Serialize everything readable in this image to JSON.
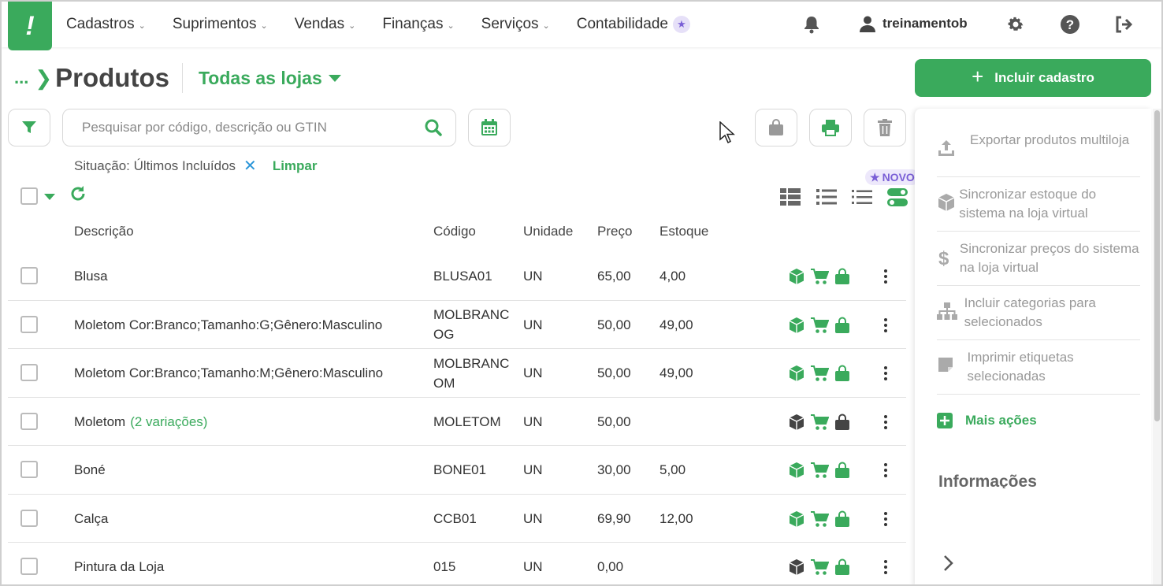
{
  "nav": {
    "items": [
      {
        "label": "Cadastros"
      },
      {
        "label": "Suprimentos"
      },
      {
        "label": "Vendas"
      },
      {
        "label": "Finanças"
      },
      {
        "label": "Serviços"
      },
      {
        "label": "Contabilidade"
      }
    ],
    "username": "treinamentob",
    "logo_text": "!"
  },
  "header": {
    "breadcrumb_dots": "...",
    "title": "Produtos",
    "store_select": "Todas as lojas",
    "primary_button": "Incluir cadastro"
  },
  "search": {
    "placeholder": "Pesquisar por código, descrição ou GTIN"
  },
  "filter": {
    "label": "Situação: Últimos Incluídos",
    "clear": "Limpar"
  },
  "badge_new": "NOVO",
  "table": {
    "headers": {
      "description": "Descrição",
      "code": "Código",
      "unit": "Unidade",
      "price": "Preço",
      "stock": "Estoque"
    },
    "rows": [
      {
        "description": "Blusa",
        "variation": "",
        "code": "BLUSA01",
        "unit": "UN",
        "price": "65,00",
        "stock": "4,00",
        "status": "green"
      },
      {
        "description": "Moletom Cor:Branco;Tamanho:G;Gênero:Masculino",
        "variation": "",
        "code": "MOLBRANCOG",
        "unit": "UN",
        "price": "50,00",
        "stock": "49,00",
        "status": "green"
      },
      {
        "description": "Moletom Cor:Branco;Tamanho:M;Gênero:Masculino",
        "variation": "",
        "code": "MOLBRANCOM",
        "unit": "UN",
        "price": "50,00",
        "stock": "49,00",
        "status": "green"
      },
      {
        "description": "Moletom",
        "variation": "(2 variações)",
        "code": "MOLETOM",
        "unit": "UN",
        "price": "50,00",
        "stock": "",
        "status": "dark"
      },
      {
        "description": "Boné",
        "variation": "",
        "code": "BONE01",
        "unit": "UN",
        "price": "30,00",
        "stock": "5,00",
        "status": "green"
      },
      {
        "description": "Calça",
        "variation": "",
        "code": "CCB01",
        "unit": "UN",
        "price": "69,90",
        "stock": "12,00",
        "status": "green"
      },
      {
        "description": "Pintura da Loja",
        "variation": "",
        "code": "015",
        "unit": "UN",
        "price": "0,00",
        "stock": "",
        "status": "mixed"
      }
    ]
  },
  "side_panel": {
    "actions": [
      {
        "label": "Exportar produtos multiloja",
        "icon": "upload-icon"
      },
      {
        "label": "Sincronizar estoque do sistema na loja virtual",
        "icon": "box-icon"
      },
      {
        "label": "Sincronizar preços do sistema na loja virtual",
        "icon": "dollar-icon"
      },
      {
        "label": "Incluir categorias para selecionados",
        "icon": "sitemap-icon"
      },
      {
        "label": "Imprimir etiquetas selecionadas",
        "icon": "label-icon"
      }
    ],
    "more": "Mais ações",
    "info_heading": "Informações"
  },
  "colors": {
    "brand_green": "#3aaa5c",
    "link_blue": "#2a95d8",
    "purple": "#7a5fd6"
  }
}
